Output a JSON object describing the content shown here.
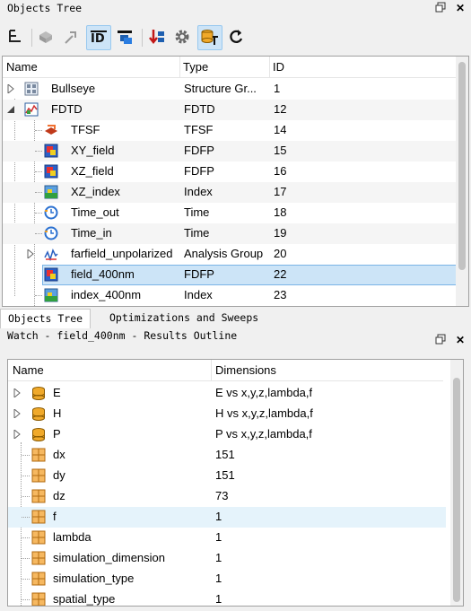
{
  "objects_panel": {
    "title": "Objects Tree",
    "float_icon": "float-icon",
    "close_icon": "close-icon",
    "toolbar": [
      "tree-structure-icon",
      "insert-object-icon",
      "pointer-icon",
      "2d-3d-view-icon",
      "bring-front-icon",
      "sort-icon",
      "settings-gear-icon",
      "database-filter-icon",
      "refresh-icon"
    ],
    "columns": [
      "Name",
      "Type",
      "ID"
    ],
    "rows": [
      {
        "name": "Bullseye",
        "type": "Structure Gr...",
        "id": "1",
        "icon": "structure-group-icon"
      },
      {
        "name": "FDTD",
        "type": "FDTD",
        "id": "12",
        "icon": "fdtd-icon"
      },
      {
        "name": "TFSF",
        "type": "TFSF",
        "id": "14",
        "icon": "tfsf-source-icon"
      },
      {
        "name": "XY_field",
        "type": "FDFP",
        "id": "15",
        "icon": "field-monitor-icon"
      },
      {
        "name": "XZ_field",
        "type": "FDFP",
        "id": "16",
        "icon": "field-monitor-icon"
      },
      {
        "name": "XZ_index",
        "type": "Index",
        "id": "17",
        "icon": "index-monitor-icon"
      },
      {
        "name": "Time_out",
        "type": "Time",
        "id": "18",
        "icon": "time-monitor-icon"
      },
      {
        "name": "Time_in",
        "type": "Time",
        "id": "19",
        "icon": "time-monitor-icon"
      },
      {
        "name": "farfield_unpolarized",
        "type": "Analysis Group",
        "id": "20",
        "icon": "analysis-group-icon"
      },
      {
        "name": "field_400nm",
        "type": "FDFP",
        "id": "22",
        "icon": "field-monitor-icon"
      },
      {
        "name": "index_400nm",
        "type": "Index",
        "id": "23",
        "icon": "index-monitor-icon"
      }
    ]
  },
  "tabs": [
    "Objects Tree",
    "Optimizations and Sweeps"
  ],
  "watch_panel": {
    "title": "Watch - field_400nm - Results Outline",
    "columns": [
      "Name",
      "Dimensions"
    ],
    "rows": [
      {
        "name": "E",
        "dims": "E vs x,y,z,lambda,f",
        "icon": "database-icon"
      },
      {
        "name": "H",
        "dims": "H vs x,y,z,lambda,f",
        "icon": "database-icon"
      },
      {
        "name": "P",
        "dims": "P vs x,y,z,lambda,f",
        "icon": "database-icon"
      },
      {
        "name": "dx",
        "dims": "151",
        "icon": "matrix-icon"
      },
      {
        "name": "dy",
        "dims": "151",
        "icon": "matrix-icon"
      },
      {
        "name": "dz",
        "dims": "73",
        "icon": "matrix-icon"
      },
      {
        "name": "f",
        "dims": "1",
        "icon": "matrix-icon"
      },
      {
        "name": "lambda",
        "dims": "1",
        "icon": "matrix-icon"
      },
      {
        "name": "simulation_dimension",
        "dims": "1",
        "icon": "matrix-icon"
      },
      {
        "name": "simulation_type",
        "dims": "1",
        "icon": "matrix-icon"
      },
      {
        "name": "spatial_type",
        "dims": "1",
        "icon": "matrix-icon"
      }
    ]
  }
}
